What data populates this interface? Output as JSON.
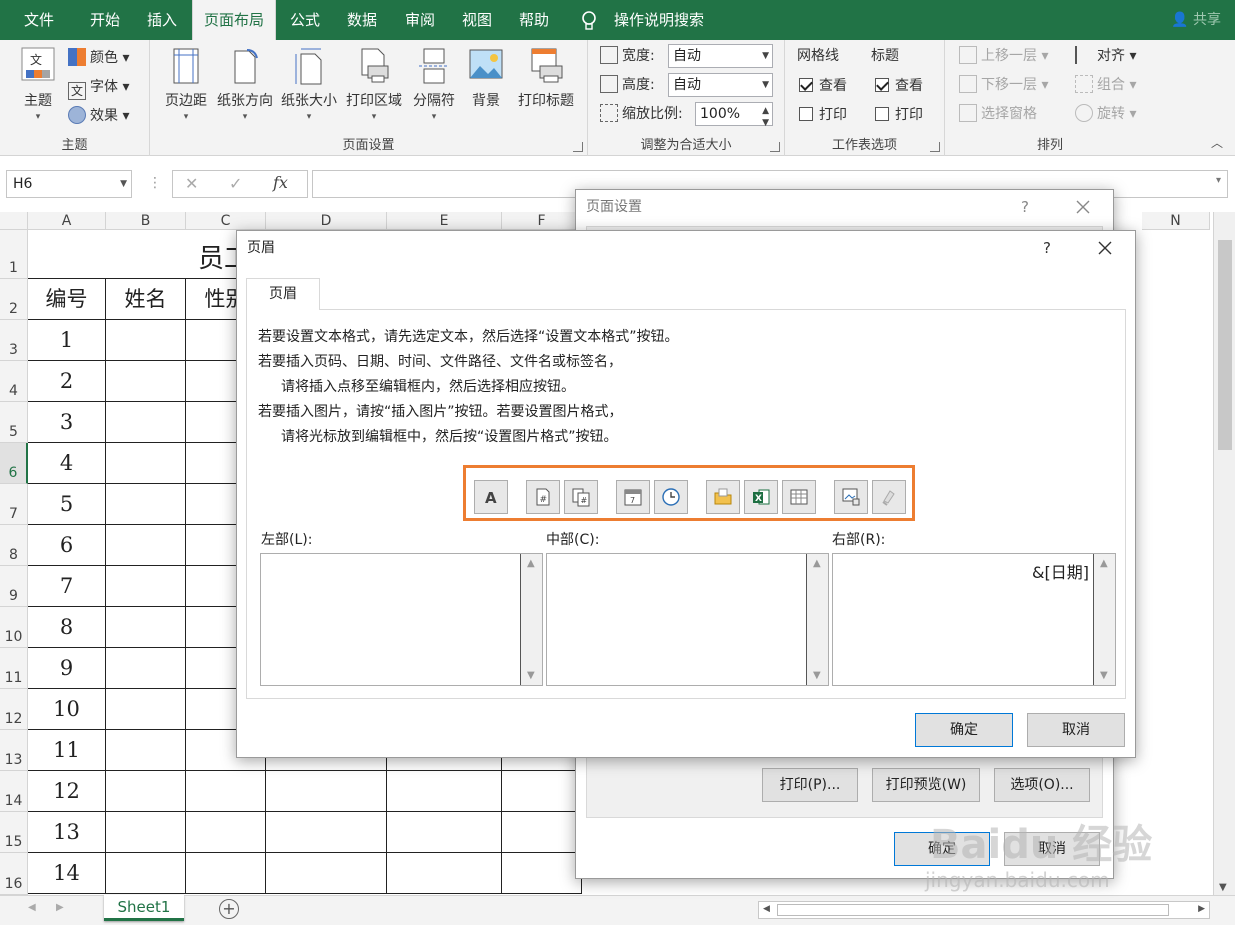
{
  "ribbon": {
    "tabs": [
      "文件",
      "开始",
      "插入",
      "页面布局",
      "公式",
      "数据",
      "审阅",
      "视图",
      "帮助"
    ],
    "active_tab": "页面布局",
    "search_label": "操作说明搜索",
    "share_label": "共享",
    "theme_group": {
      "label": "主题",
      "theme_btn": "主题",
      "colors": "颜色",
      "fonts": "字体",
      "effects": "效果"
    },
    "page_setup_group": {
      "label": "页面设置",
      "buttons": [
        "页边距",
        "纸张方向",
        "纸张大小",
        "打印区域",
        "分隔符",
        "背景",
        "打印标题"
      ]
    },
    "scale_group": {
      "label": "调整为合适大小",
      "width_label": "宽度:",
      "width_value": "自动",
      "height_label": "高度:",
      "height_value": "自动",
      "scale_label": "缩放比例:",
      "scale_value": "100%"
    },
    "sheet_options_group": {
      "label": "工作表选项",
      "gridlines": "网格线",
      "headings": "标题",
      "view": "查看",
      "print": "打印"
    },
    "arrange_group": {
      "label": "排列",
      "bring_forward": "上移一层",
      "send_backward": "下移一层",
      "selection_pane": "选择窗格",
      "align": "对齐",
      "group": "组合",
      "rotate": "旋转"
    }
  },
  "formula_bar": {
    "name_box": "H6",
    "fx": "fx"
  },
  "sheet": {
    "columns": [
      "A",
      "B",
      "C",
      "D",
      "E",
      "F",
      "N"
    ],
    "rows": [
      "1",
      "2",
      "3",
      "4",
      "5",
      "6",
      "7",
      "8",
      "9",
      "10",
      "11",
      "12",
      "13",
      "14",
      "15",
      "16"
    ],
    "title_partial": "员工",
    "headers": [
      "编号",
      "姓名",
      "性别"
    ],
    "ids": [
      "1",
      "2",
      "3",
      "4",
      "5",
      "6",
      "7",
      "8",
      "9",
      "10",
      "11",
      "12",
      "13",
      "14"
    ],
    "tab_name": "Sheet1"
  },
  "page_setup_dialog": {
    "title": "页面设置",
    "help": "?",
    "print_btn": "打印(P)...",
    "preview_btn": "打印预览(W)",
    "options_btn": "选项(O)...",
    "ok_btn": "确定",
    "cancel_btn": "取消"
  },
  "header_dialog": {
    "title": "页眉",
    "help": "?",
    "tab": "页眉",
    "instructions": [
      "若要设置文本格式，请先选定文本，然后选择“设置文本格式”按钮。",
      "若要插入页码、日期、时间、文件路径、文件名或标签名，",
      "请将插入点移至编辑框内，然后选择相应按钮。",
      "若要插入图片，请按“插入图片”按钮。若要设置图片格式，",
      "请将光标放到编辑框中，然后按“设置图片格式”按钮。"
    ],
    "left_label": "左部(L):",
    "center_label": "中部(C):",
    "right_label": "右部(R):",
    "right_content": "&[日期]",
    "ok_btn": "确定",
    "cancel_btn": "取消",
    "highlight_color": "#ed7d31"
  },
  "watermark": {
    "text": "Baidu 经验",
    "sub": "jingyan.baidu.com"
  }
}
